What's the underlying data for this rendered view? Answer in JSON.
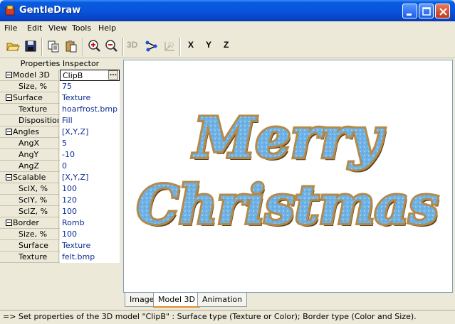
{
  "window": {
    "title": "GentleDraw"
  },
  "menu": [
    {
      "label": "File"
    },
    {
      "label": "Edit"
    },
    {
      "label": "View"
    },
    {
      "label": "Tools"
    },
    {
      "label": "Help"
    }
  ],
  "toolbar": {
    "btn_3d": "3D",
    "axis_x": "X",
    "axis_y": "Y",
    "axis_z": "Z"
  },
  "inspector": {
    "title": "Properties Inspector",
    "rows": [
      {
        "name": "Model 3D",
        "value": "ClipB"
      },
      {
        "name": "Size, %",
        "value": "75"
      },
      {
        "name": "Surface",
        "value": "Texture"
      },
      {
        "name": "Texture",
        "value": "hoarfrost.bmp"
      },
      {
        "name": "Disposition",
        "value": "Fill"
      },
      {
        "name": "Angles",
        "value": "[X,Y,Z]"
      },
      {
        "name": "AngX",
        "value": "5"
      },
      {
        "name": "AngY",
        "value": "-10"
      },
      {
        "name": "AngZ",
        "value": "0"
      },
      {
        "name": "Scalable",
        "value": "[X,Y,Z]"
      },
      {
        "name": "SclX, %",
        "value": "100"
      },
      {
        "name": "SclY, %",
        "value": "120"
      },
      {
        "name": "SclZ, %",
        "value": "100"
      },
      {
        "name": "Border",
        "value": "Romb"
      },
      {
        "name": "Size, %",
        "value": "100"
      },
      {
        "name": "Surface",
        "value": "Texture"
      },
      {
        "name": "Texture",
        "value": "felt.bmp"
      }
    ],
    "ellipsis": "..."
  },
  "canvas": {
    "line1": "Merry",
    "line2": "Christmas",
    "fill_color": "#6fb3e6",
    "border_color": "#b38a4a"
  },
  "tabs": [
    {
      "label": "Image"
    },
    {
      "label": "Model 3D"
    },
    {
      "label": "Animation"
    }
  ],
  "status": "=> Set properties of the 3D model \"ClipB\" : Surface type (Texture or Color); Border type (Color and Size)."
}
